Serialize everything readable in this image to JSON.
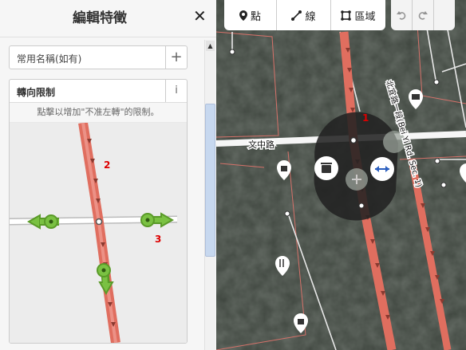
{
  "sidebar": {
    "title": "編輯特徵",
    "close_label": "✕",
    "name_field": {
      "label": "常用名稱(如有)",
      "add_label": "+"
    },
    "turn_restrictions": {
      "title": "轉向限制",
      "info_label": "i",
      "hint": "點擊以增加\"不准左轉\"的限制。",
      "labels": {
        "road2": "2",
        "road3": "3"
      }
    }
  },
  "toolbar": {
    "point_label": "點",
    "line_label": "線",
    "area_label": "區域"
  },
  "map": {
    "road_label_1": "文中路",
    "road_label_2": "北宜路一段(Bei Yi Rd. Sec. 1)",
    "marker_label_1": "1"
  },
  "colors": {
    "accent": "#e06e5f",
    "turn_allow": "#7ac142"
  }
}
